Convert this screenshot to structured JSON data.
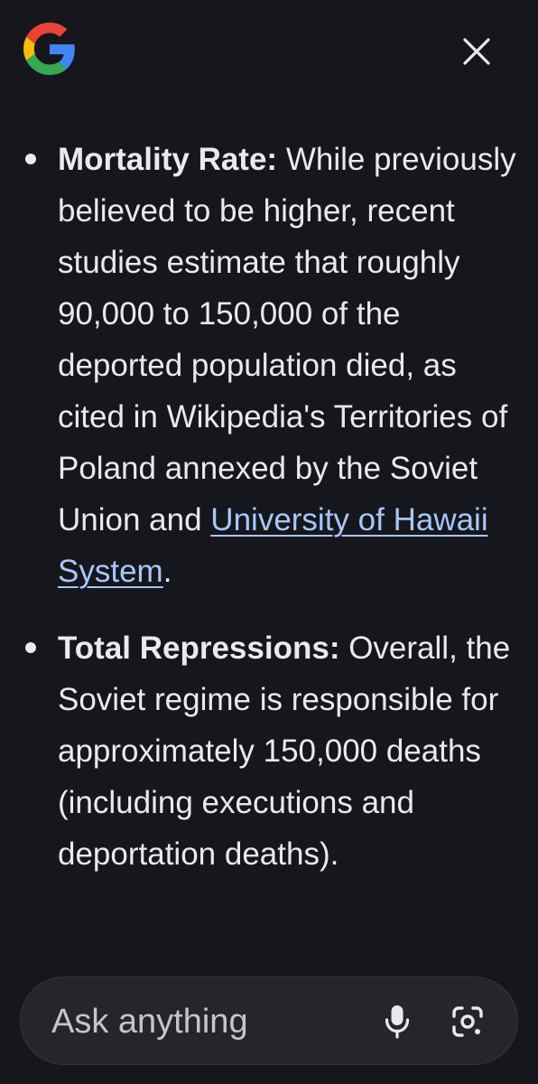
{
  "header": {
    "logo_icon": "google-g-logo",
    "close_icon": "close-icon"
  },
  "answer": {
    "items": [
      {
        "term": "Mortality Rate:",
        "text": " While previously believed to be higher, recent studies estimate that roughly 90,000 to 150,000 of the deported population died, as cited in Wikipedia's Territories of Poland annexed by the Soviet Union and ",
        "link": "University of Hawaii System",
        "after": "."
      },
      {
        "term": "Total Repressions:",
        "text": " Overall, the Soviet regime is responsible for approximately 150,000 deaths (including executions and deportation deaths)."
      }
    ]
  },
  "search": {
    "placeholder": "Ask anything",
    "value": "",
    "mic_icon": "microphone-icon",
    "lens_icon": "google-lens-icon"
  },
  "colors": {
    "background": "#16171c",
    "text": "#e8eaed",
    "link": "#a8c7fa",
    "search_bar": "#24262b"
  }
}
